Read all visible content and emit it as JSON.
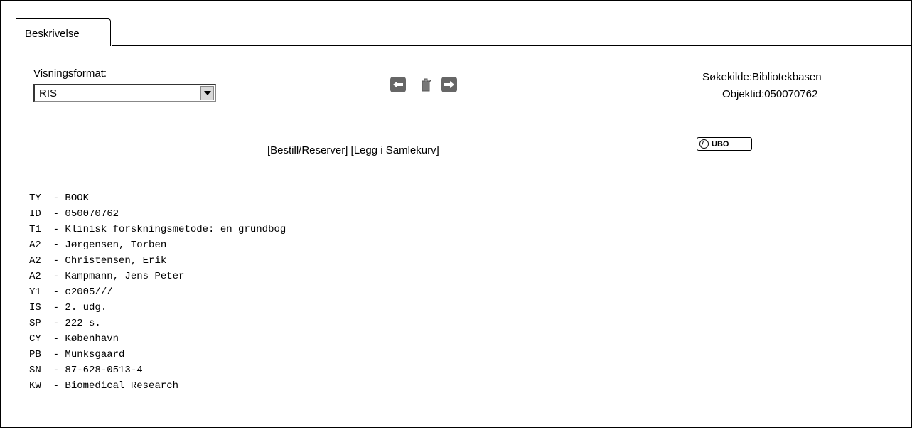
{
  "tab": {
    "label": "Beskrivelse"
  },
  "format": {
    "label": "Visningsformat:",
    "selected": "RIS"
  },
  "source": {
    "search_source_label": "Søkekilde:",
    "search_source_value": "Bibliotekbasen",
    "object_id_label": "Objektid:",
    "object_id_value": "050070762"
  },
  "actions": {
    "order": "[Bestill/Reserver]",
    "basket": "[Legg i Samlekurv]"
  },
  "ubo_badge": "UBO",
  "ris": [
    {
      "tag": "TY",
      "value": "BOOK"
    },
    {
      "tag": "ID",
      "value": "050070762"
    },
    {
      "tag": "T1",
      "value": "Klinisk forskningsmetode: en grundbog"
    },
    {
      "tag": "A2",
      "value": "Jørgensen, Torben"
    },
    {
      "tag": "A2",
      "value": "Christensen, Erik"
    },
    {
      "tag": "A2",
      "value": "Kampmann, Jens Peter"
    },
    {
      "tag": "Y1",
      "value": "c2005///"
    },
    {
      "tag": "IS",
      "value": "2. udg."
    },
    {
      "tag": "SP",
      "value": "222 s."
    },
    {
      "tag": "CY",
      "value": "København"
    },
    {
      "tag": "PB",
      "value": "Munksgaard"
    },
    {
      "tag": "SN",
      "value": "87-628-0513-4"
    },
    {
      "tag": "KW",
      "value": "Biomedical Research"
    }
  ]
}
